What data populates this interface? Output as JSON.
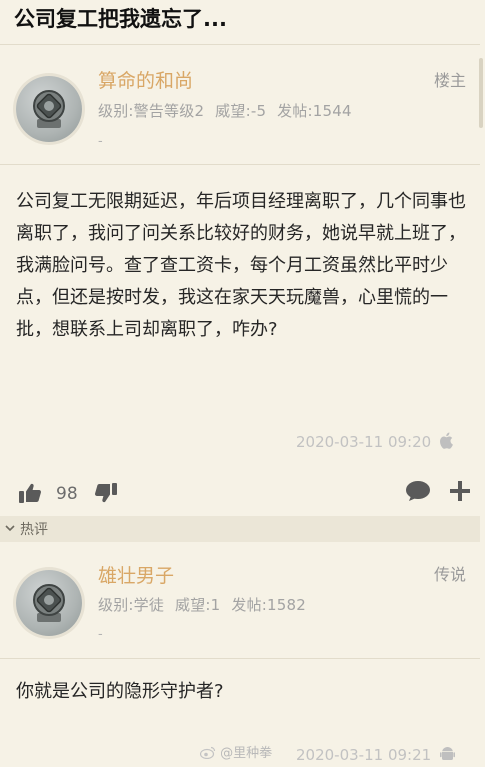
{
  "thread": {
    "title": "公司复工把我遗忘了..."
  },
  "main_post": {
    "username": "算命的和尚",
    "role": "楼主",
    "level_label": "级别:警告等级2",
    "prestige_label": "威望:-5",
    "posts_label": "发帖:1544",
    "dash": "-",
    "content": "公司复工无限期延迟，年后项目经理离职了，几个同事也离职了，我问了问关系比较好的财务，她说早就上班了，我满脸问号。查了查工资卡，每个月工资虽然比平时少点，但还是按时发，我这在家天天玩魔兽，心里慌的一批，想联系上司却离职了，咋办?",
    "timestamp": "2020-03-11 09:20",
    "device": "apple-icon",
    "like_count": "98"
  },
  "hot_section": {
    "label": "热评"
  },
  "reply": {
    "username": "雄壮男子",
    "role": "传说",
    "level_label": "级别:学徒",
    "prestige_label": "威望:1",
    "posts_label": "发帖:1582",
    "dash": "-",
    "content": "你就是公司的隐形守护者?",
    "timestamp": "2020-03-11 09:21",
    "device": "android-icon"
  },
  "watermark": {
    "text": "@里种拳"
  },
  "colors": {
    "background": "#f6f2e6",
    "username": "#d9a766",
    "section_bg": "#ebe6d7"
  }
}
